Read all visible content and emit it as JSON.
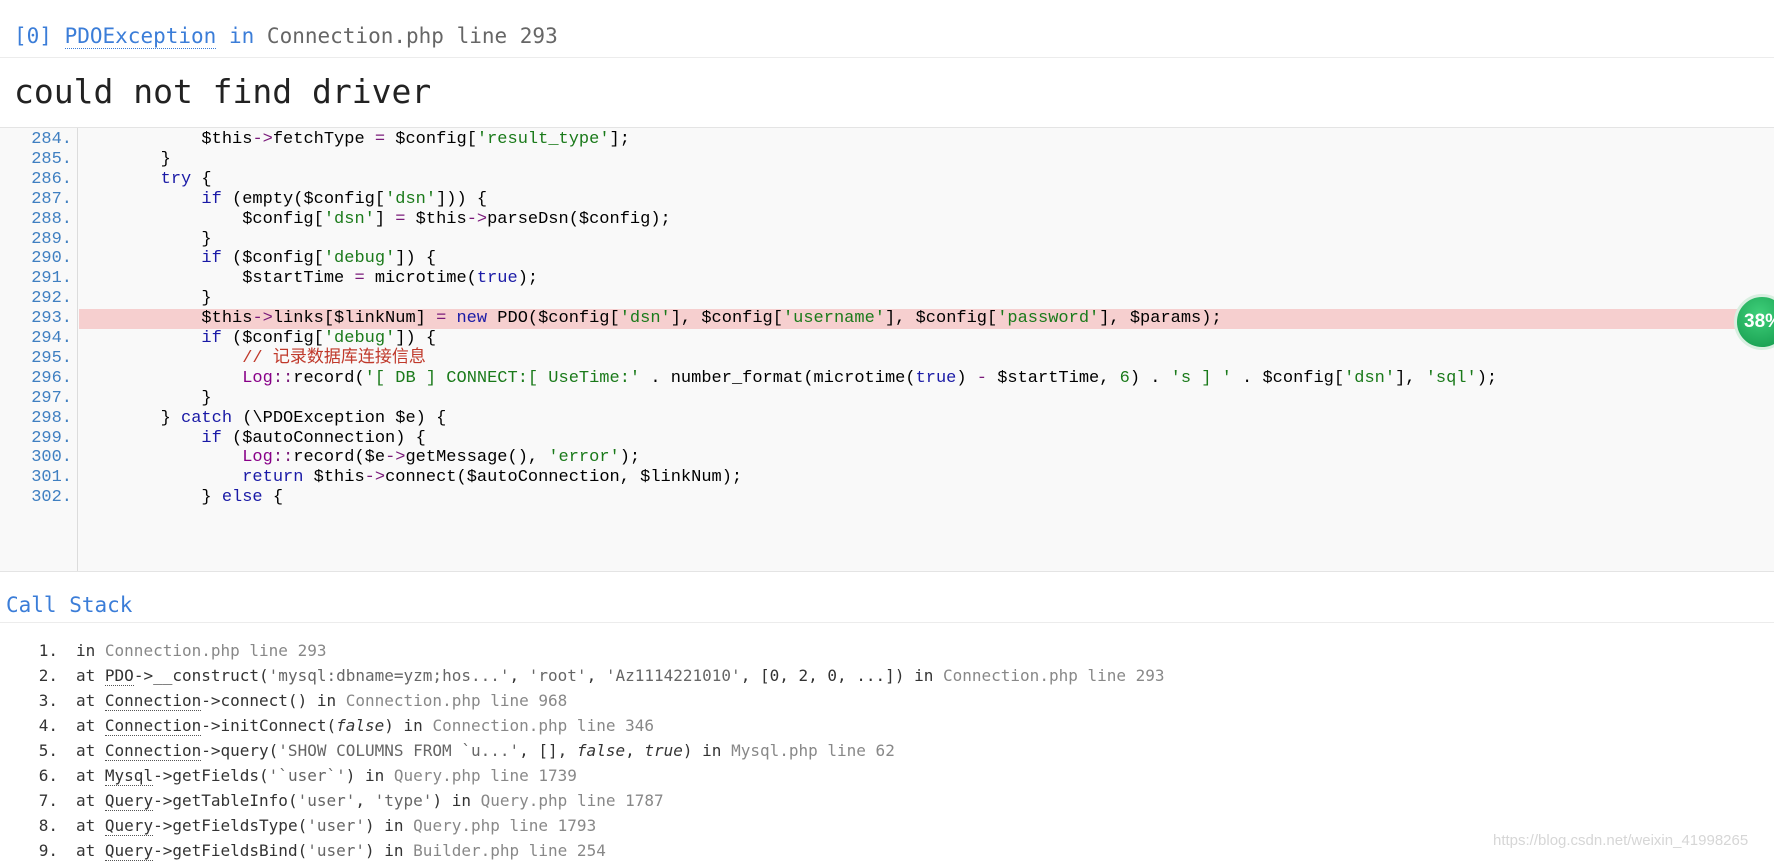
{
  "exception": {
    "index": "[0]",
    "class": "PDOException",
    "in_label": "in",
    "location": "Connection.php line 293",
    "message": "could not find driver"
  },
  "source": {
    "highlight_line": "293.",
    "lines": [
      {
        "no": "284.",
        "tokens": [
          [
            "",
            "            "
          ],
          [
            "var",
            "$this"
          ],
          [
            "op",
            "->"
          ],
          [
            "",
            "fetchType "
          ],
          [
            "op",
            "="
          ],
          [
            "",
            " $config["
          ],
          [
            "str",
            "'result_type'"
          ],
          [
            "",
            "];"
          ]
        ]
      },
      {
        "no": "285.",
        "tokens": [
          [
            "",
            "        }"
          ]
        ]
      },
      {
        "no": "286.",
        "tokens": [
          [
            "",
            "        "
          ],
          [
            "kw",
            "try"
          ],
          [
            "",
            " {"
          ]
        ]
      },
      {
        "no": "287.",
        "tokens": [
          [
            "",
            "            "
          ],
          [
            "kw",
            "if"
          ],
          [
            "",
            " (empty($config["
          ],
          [
            "str",
            "'dsn'"
          ],
          [
            "",
            "])) {"
          ]
        ]
      },
      {
        "no": "288.",
        "tokens": [
          [
            "",
            "                $config["
          ],
          [
            "str",
            "'dsn'"
          ],
          [
            "",
            "] "
          ],
          [
            "op",
            "="
          ],
          [
            "",
            " $this"
          ],
          [
            "op",
            "->"
          ],
          [
            "",
            "parseDsn($config);"
          ]
        ]
      },
      {
        "no": "289.",
        "tokens": [
          [
            "",
            "            }"
          ]
        ]
      },
      {
        "no": "290.",
        "tokens": [
          [
            "",
            "            "
          ],
          [
            "kw",
            "if"
          ],
          [
            "",
            " ($config["
          ],
          [
            "str",
            "'debug'"
          ],
          [
            "",
            "]) {"
          ]
        ]
      },
      {
        "no": "291.",
        "tokens": [
          [
            "",
            "                $startTime "
          ],
          [
            "op",
            "="
          ],
          [
            "",
            " microtime("
          ],
          [
            "kw",
            "true"
          ],
          [
            "",
            ");"
          ]
        ]
      },
      {
        "no": "292.",
        "tokens": [
          [
            "",
            "            }"
          ]
        ]
      },
      {
        "no": "293.",
        "tokens": [
          [
            "",
            "            $this"
          ],
          [
            "op",
            "->"
          ],
          [
            "",
            "links[$linkNum] "
          ],
          [
            "op",
            "="
          ],
          [
            "",
            " "
          ],
          [
            "kw",
            "new"
          ],
          [
            "",
            " PDO($config["
          ],
          [
            "str",
            "'dsn'"
          ],
          [
            "",
            "], $config["
          ],
          [
            "str",
            "'username'"
          ],
          [
            "",
            "], $config["
          ],
          [
            "str",
            "'password'"
          ],
          [
            "",
            "], $params);"
          ]
        ]
      },
      {
        "no": "294.",
        "tokens": [
          [
            "",
            "            "
          ],
          [
            "kw",
            "if"
          ],
          [
            "",
            " ($config["
          ],
          [
            "str",
            "'debug'"
          ],
          [
            "",
            "]) {"
          ]
        ]
      },
      {
        "no": "295.",
        "tokens": [
          [
            "",
            "                "
          ],
          [
            "cmt",
            "// 记录数据库连接信息"
          ]
        ]
      },
      {
        "no": "296.",
        "tokens": [
          [
            "",
            "                "
          ],
          [
            "cls",
            "Log"
          ],
          [
            "op",
            "::"
          ],
          [
            "",
            "record("
          ],
          [
            "str",
            "'[ DB ] CONNECT:[ UseTime:'"
          ],
          [
            "",
            " . number_format(microtime("
          ],
          [
            "kw",
            "true"
          ],
          [
            "",
            ") "
          ],
          [
            "op",
            "-"
          ],
          [
            "",
            " $startTime, "
          ],
          [
            "num",
            "6"
          ],
          [
            "",
            ") . "
          ],
          [
            "str",
            "'s ] '"
          ],
          [
            "",
            " . $config["
          ],
          [
            "str",
            "'dsn'"
          ],
          [
            "",
            "], "
          ],
          [
            "str",
            "'sql'"
          ],
          [
            "",
            ");"
          ]
        ]
      },
      {
        "no": "297.",
        "tokens": [
          [
            "",
            "            }"
          ]
        ]
      },
      {
        "no": "298.",
        "tokens": [
          [
            "",
            "        } "
          ],
          [
            "kw",
            "catch"
          ],
          [
            "",
            " (\\PDOException $e) {"
          ]
        ]
      },
      {
        "no": "299.",
        "tokens": [
          [
            "",
            "            "
          ],
          [
            "kw",
            "if"
          ],
          [
            "",
            " ($autoConnection) {"
          ]
        ]
      },
      {
        "no": "300.",
        "tokens": [
          [
            "",
            "                "
          ],
          [
            "cls",
            "Log"
          ],
          [
            "op",
            "::"
          ],
          [
            "",
            "record($e"
          ],
          [
            "op",
            "->"
          ],
          [
            "",
            "getMessage(), "
          ],
          [
            "str",
            "'error'"
          ],
          [
            "",
            ");"
          ]
        ]
      },
      {
        "no": "301.",
        "tokens": [
          [
            "",
            "                "
          ],
          [
            "kw",
            "return"
          ],
          [
            "",
            " $this"
          ],
          [
            "op",
            "->"
          ],
          [
            "",
            "connect($autoConnection, $linkNum);"
          ]
        ]
      },
      {
        "no": "302.",
        "tokens": [
          [
            "",
            "            } "
          ],
          [
            "kw",
            "else"
          ],
          [
            "",
            " {"
          ]
        ]
      }
    ]
  },
  "call_stack": {
    "title": "Call Stack",
    "items": [
      {
        "num": "1.",
        "parts": [
          [
            "",
            "in "
          ],
          [
            "file",
            "Connection.php line 293"
          ]
        ]
      },
      {
        "num": "2.",
        "parts": [
          [
            "",
            "at "
          ],
          [
            "abbr",
            "PDO"
          ],
          [
            "",
            "->__construct("
          ],
          [
            "arg",
            "'mysql:dbname=yzm;hos...'"
          ],
          [
            "",
            ", "
          ],
          [
            "arg",
            "'root'"
          ],
          [
            "",
            ", "
          ],
          [
            "arg",
            "'Az1114221010'"
          ],
          [
            "",
            ", [0, 2, 0, ...]) in "
          ],
          [
            "file",
            "Connection.php line 293"
          ]
        ]
      },
      {
        "num": "3.",
        "parts": [
          [
            "",
            "at "
          ],
          [
            "abbr",
            "Connection"
          ],
          [
            "",
            "->connect() in "
          ],
          [
            "file",
            "Connection.php line 968"
          ]
        ]
      },
      {
        "num": "4.",
        "parts": [
          [
            "",
            "at "
          ],
          [
            "abbr",
            "Connection"
          ],
          [
            "",
            "->initConnect("
          ],
          [
            "em",
            "false"
          ],
          [
            "",
            ") in "
          ],
          [
            "file",
            "Connection.php line 346"
          ]
        ]
      },
      {
        "num": "5.",
        "parts": [
          [
            "",
            "at "
          ],
          [
            "abbr",
            "Connection"
          ],
          [
            "",
            "->query("
          ],
          [
            "arg",
            "'SHOW COLUMNS FROM `u...'"
          ],
          [
            "",
            ", [], "
          ],
          [
            "em",
            "false"
          ],
          [
            "",
            ", "
          ],
          [
            "em",
            "true"
          ],
          [
            "",
            ") in "
          ],
          [
            "file",
            "Mysql.php line 62"
          ]
        ]
      },
      {
        "num": "6.",
        "parts": [
          [
            "",
            "at "
          ],
          [
            "abbr",
            "Mysql"
          ],
          [
            "",
            "->getFields("
          ],
          [
            "arg",
            "'`user`'"
          ],
          [
            "",
            ") in "
          ],
          [
            "file",
            "Query.php line 1739"
          ]
        ]
      },
      {
        "num": "7.",
        "parts": [
          [
            "",
            "at "
          ],
          [
            "abbr",
            "Query"
          ],
          [
            "",
            "->getTableInfo("
          ],
          [
            "arg",
            "'user'"
          ],
          [
            "",
            ", "
          ],
          [
            "arg",
            "'type'"
          ],
          [
            "",
            ") in "
          ],
          [
            "file",
            "Query.php line 1787"
          ]
        ]
      },
      {
        "num": "8.",
        "parts": [
          [
            "",
            "at "
          ],
          [
            "abbr",
            "Query"
          ],
          [
            "",
            "->getFieldsType("
          ],
          [
            "arg",
            "'user'"
          ],
          [
            "",
            ") in "
          ],
          [
            "file",
            "Query.php line 1793"
          ]
        ]
      },
      {
        "num": "9.",
        "parts": [
          [
            "",
            "at "
          ],
          [
            "abbr",
            "Query"
          ],
          [
            "",
            "->getFieldsBind("
          ],
          [
            "arg",
            "'user'"
          ],
          [
            "",
            ") in "
          ],
          [
            "file",
            "Builder.php line 254"
          ]
        ]
      }
    ]
  },
  "badge": {
    "text": "38%",
    "color": "#12964a"
  },
  "watermark": "https://blog.csdn.net/weixin_41998265"
}
